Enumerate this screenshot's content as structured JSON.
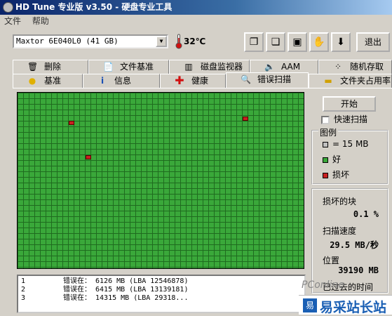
{
  "window": {
    "title": "HD Tune 专业版 v3.50 - 硬盘专业工具"
  },
  "menu": [
    "文件",
    "帮助"
  ],
  "toolbar": {
    "drive": "Maxtor 6E040L0 (41 GB)",
    "temperature": "32℃",
    "exit_label": "退出",
    "icons": [
      "copy-icon",
      "copy-all-icon",
      "save-icon",
      "options-icon",
      "download-icon"
    ]
  },
  "tabs_top": [
    {
      "label": "删除",
      "icon": "trash-icon"
    },
    {
      "label": "文件基准",
      "icon": "file-benchmark-icon"
    },
    {
      "label": "磁盘监视器",
      "icon": "monitor-chart-icon"
    },
    {
      "label": "AAM",
      "icon": "speaker-icon"
    },
    {
      "label": "随机存取",
      "icon": "random-access-icon"
    }
  ],
  "tabs_bottom": [
    {
      "label": "基准",
      "icon": "benchmark-icon"
    },
    {
      "label": "信息",
      "icon": "info-icon"
    },
    {
      "label": "健康",
      "icon": "health-cross-icon"
    },
    {
      "label": "错误扫描",
      "icon": "magnifier-icon",
      "active": true
    },
    {
      "label": "文件夹占用率",
      "icon": "folder-icon"
    }
  ],
  "scan": {
    "start_label": "开始",
    "quick_scan_label": "快速扫描",
    "quick_scan_checked": false,
    "bad_blocks_shown": 3
  },
  "legend": {
    "title": "图例",
    "items": [
      {
        "label": "= 15 MB",
        "color": "#c0c0c0"
      },
      {
        "label": "好",
        "color": "#3aa83a"
      },
      {
        "label": "损坏",
        "color": "#c82020"
      }
    ]
  },
  "stats": {
    "damaged_label": "损坏的块",
    "damaged_value": "0.1 %",
    "speed_label": "扫描速度",
    "speed_value": "29.5 MB/秒",
    "position_label": "位置",
    "position_value": "39190 MB",
    "elapsed_label": "已过去的时间"
  },
  "log": [
    {
      "n": "1",
      "text": "错误在： 6126 MB (LBA 12546878)"
    },
    {
      "n": "2",
      "text": "错误在： 6415 MB (LBA 13139181)"
    },
    {
      "n": "3",
      "text": "错误在： 14315 MB (LBA 29318..."
    }
  ],
  "watermark": {
    "brand": "PConline",
    "site": "易采站长站"
  }
}
